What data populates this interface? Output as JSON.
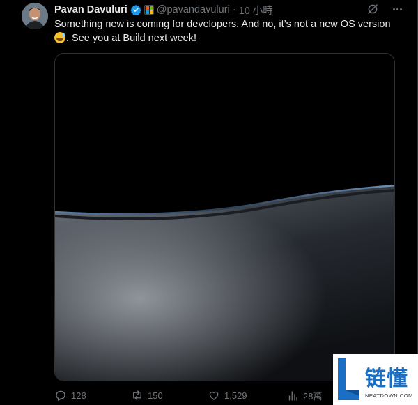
{
  "tweet": {
    "author_name": "Pavan Davuluri",
    "handle": "@pavandavuluri",
    "separator": "·",
    "time": "10 小時",
    "text_main": "Something new is coming for developers. And no, it’s not a new OS version",
    "text_after_emoji": ". See you at Build next week!",
    "emoji_icon": "grinning-sweat-emoji"
  },
  "actions": {
    "replies": "128",
    "reposts": "150",
    "likes": "1,529",
    "views": "28萬"
  },
  "watermark": {
    "brand_cn": "链懂",
    "brand_en": "NEATDOWN.COM"
  },
  "colors": {
    "background": "#000000",
    "text_primary": "#e7e9ea",
    "text_secondary": "#71767b",
    "verified_blue": "#1d9bf0",
    "watermark_blue": "#1a6fc4"
  }
}
